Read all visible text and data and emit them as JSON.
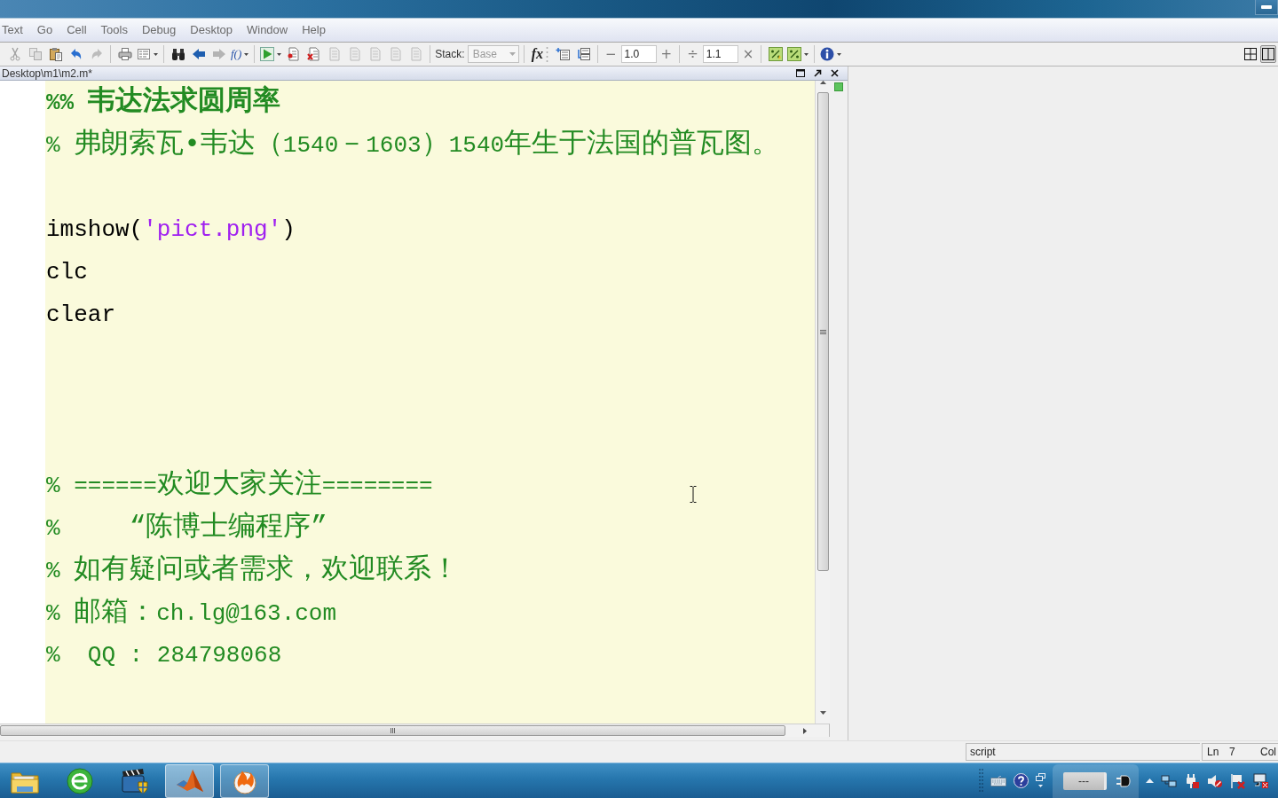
{
  "menu_bar": {
    "items": [
      "Text",
      "Go",
      "Cell",
      "Tools",
      "Debug",
      "Desktop",
      "Window",
      "Help"
    ]
  },
  "toolbar": {
    "groups": [
      {
        "items": [
          {
            "kind": "cut",
            "disabled": true,
            "dropdown": false
          },
          {
            "kind": "copy",
            "disabled": true,
            "dropdown": false
          },
          {
            "kind": "paste",
            "disabled": false,
            "dropdown": false
          },
          {
            "kind": "undo",
            "disabled": false,
            "dropdown": false
          },
          {
            "kind": "redo",
            "disabled": true,
            "dropdown": false
          }
        ]
      },
      {
        "items": [
          {
            "kind": "print",
            "disabled": false,
            "dropdown": false
          },
          {
            "kind": "comment",
            "disabled": false,
            "dropdown": true
          }
        ]
      },
      {
        "items": [
          {
            "kind": "find",
            "disabled": false,
            "dropdown": false
          },
          {
            "kind": "back",
            "disabled": false,
            "dropdown": false
          },
          {
            "kind": "forward",
            "disabled": true,
            "dropdown": false
          },
          {
            "kind": "function",
            "label": "f()",
            "disabled": false,
            "dropdown": true
          }
        ]
      },
      {
        "items": [
          {
            "kind": "run",
            "disabled": false,
            "dropdown": true
          },
          {
            "kind": "set-breakpoint",
            "disabled": false,
            "dropdown": false
          },
          {
            "kind": "clear-breakpoints",
            "disabled": false,
            "dropdown": false
          },
          {
            "kind": "step",
            "disabled": true,
            "dropdown": false
          },
          {
            "kind": "step-in",
            "disabled": true,
            "dropdown": false
          },
          {
            "kind": "step-out",
            "disabled": true,
            "dropdown": false
          },
          {
            "kind": "continue",
            "disabled": true,
            "dropdown": false
          },
          {
            "kind": "exit-debug",
            "disabled": true,
            "dropdown": false
          }
        ]
      }
    ],
    "stack": {
      "label": "Stack:",
      "value": "Base",
      "disabled": true
    },
    "insert_function": {
      "label": "fx"
    },
    "cell_tools": [
      {
        "kind": "insert-cell",
        "disabled": false,
        "dropdown": false
      },
      {
        "kind": "cell-divider",
        "disabled": false,
        "dropdown": false
      }
    ],
    "cell_step": {
      "decrement": "−",
      "value": "1.0",
      "increment": "+"
    },
    "cell_scale": {
      "divide": "÷",
      "value": "1.1",
      "multiply": "×"
    },
    "eval_tools": [
      {
        "kind": "eval-cell",
        "disabled": false,
        "dropdown": false
      },
      {
        "kind": "eval-cell-advance",
        "disabled": false,
        "dropdown": true
      }
    ],
    "help_tools": [
      {
        "kind": "help",
        "disabled": false,
        "dropdown": true
      }
    ],
    "layout_buttons": [
      {
        "kind": "tile",
        "selected": false
      },
      {
        "kind": "split",
        "selected": true
      }
    ]
  },
  "editor": {
    "title": "Desktop\\m1\\m2.m*",
    "lines": [
      {
        "kind": "cell_title",
        "text": "%% 韦达法求圆周率"
      },
      {
        "kind": "comment",
        "text": "% 弗朗索瓦•韦达（1540－1603）1540年生于法国的普瓦图。"
      },
      {
        "kind": "blank"
      },
      {
        "kind": "code",
        "segments": [
          {
            "kind": "plain",
            "text": "imshow("
          },
          {
            "kind": "string",
            "text": "'pict.png'"
          },
          {
            "kind": "plain",
            "text": ")"
          }
        ]
      },
      {
        "kind": "code",
        "segments": [
          {
            "kind": "plain",
            "text": "clc"
          }
        ]
      },
      {
        "kind": "code",
        "segments": [
          {
            "kind": "plain",
            "text": "clear"
          }
        ]
      },
      {
        "kind": "blank"
      },
      {
        "kind": "blank"
      },
      {
        "kind": "blank"
      },
      {
        "kind": "comment",
        "text": "% ======欢迎大家关注========"
      },
      {
        "kind": "comment",
        "text": "%     “陈博士编程序”"
      },
      {
        "kind": "comment",
        "text": "% 如有疑问或者需求，欢迎联系！"
      },
      {
        "kind": "comment",
        "text": "% 邮箱：ch.lg@163.com"
      },
      {
        "kind": "comment",
        "text": "%  QQ : 284798068"
      }
    ]
  },
  "status_bar": {
    "mode": "script",
    "line_label": "Ln",
    "line_value": "7",
    "column_label": "Col"
  },
  "taskbar": {
    "apps": [
      {
        "kind": "explorer",
        "running": false,
        "selected": false
      },
      {
        "kind": "browser",
        "running": false,
        "selected": false
      },
      {
        "kind": "media",
        "running": false,
        "selected": false
      },
      {
        "kind": "matlab",
        "running": true,
        "selected": true
      },
      {
        "kind": "flame",
        "running": true,
        "selected": false
      }
    ],
    "tray": {
      "battery_text": "---"
    }
  }
}
